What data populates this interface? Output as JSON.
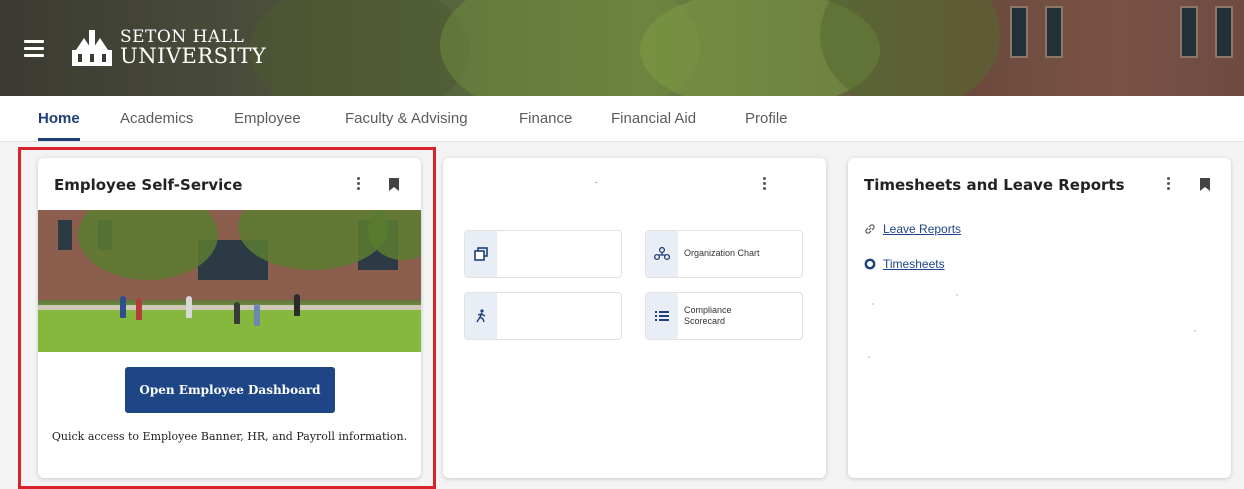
{
  "logo": {
    "line1": "SETON HALL",
    "line2": "UNIVERSITY"
  },
  "nav": {
    "tabs": [
      {
        "label": "Home"
      },
      {
        "label": "Academics"
      },
      {
        "label": "Employee"
      },
      {
        "label": "Faculty & Advising"
      },
      {
        "label": "Finance"
      },
      {
        "label": "Financial Aid"
      },
      {
        "label": "Profile"
      }
    ],
    "active": "Home"
  },
  "cards": {
    "ess": {
      "title": "Employee Self-Service",
      "button_label": "Open Employee Dashboard",
      "description": "Quick access to Employee Banner, HR, and Payroll information."
    },
    "quick_links": {
      "title": "-",
      "tiles": [
        {
          "label": "",
          "icon": "window-stack-icon"
        },
        {
          "label": "Organization Chart",
          "icon": "org-chart-icon"
        },
        {
          "label": "",
          "icon": "person-walking-icon"
        },
        {
          "label": "Compliance Scorecard",
          "icon": "list-icon"
        }
      ]
    },
    "timesheets": {
      "title": "Timesheets and Leave Reports",
      "links": [
        {
          "label": "Leave Reports",
          "icon": "link-icon"
        },
        {
          "label": "Timesheets",
          "icon": "radio-circle-icon"
        }
      ]
    }
  },
  "colors": {
    "brand": "#1e4585",
    "highlight": "#d8232a",
    "active_tab": "#1e3f7a"
  }
}
